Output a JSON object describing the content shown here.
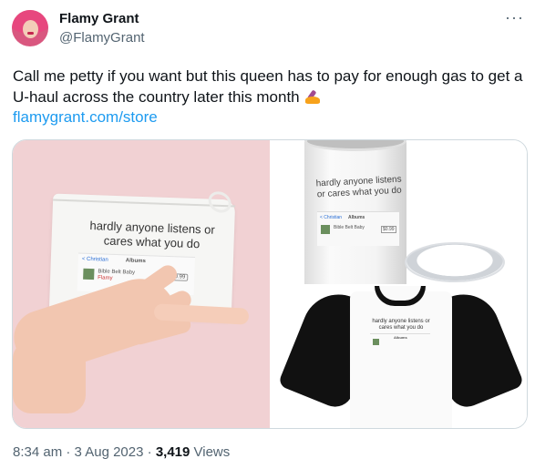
{
  "author": {
    "name": "Flamy Grant",
    "handle": "@FlamyGrant"
  },
  "more_icon": "ellipsis-icon",
  "more_symbol": "···",
  "tweet": {
    "text": "Call me petty if you want but this queen has to pay for enough gas to get a U-haul across the country later this month",
    "emoji": "lipstick-fire-emoji",
    "link": "flamygrant.com/store"
  },
  "media": {
    "pouch": {
      "text": "hardly anyone listens or cares what you do",
      "back": "< Christian",
      "title": "Albums",
      "song": "Bible Belt Baby",
      "artist": "Flamy",
      "price": "$0.99"
    },
    "tumbler": {
      "text": "hardly anyone listens or cares what you do",
      "back": "< Christian",
      "title": "Albums",
      "song": "Bible Belt Baby",
      "price": "$0.99"
    },
    "shirt": {
      "text": "hardly anyone listens or cares what you do",
      "title": "Albums"
    }
  },
  "meta": {
    "time": "8:34 am",
    "separator": " · ",
    "date": "3 Aug 2023",
    "views_count": "3,419",
    "views_label": " Views"
  }
}
